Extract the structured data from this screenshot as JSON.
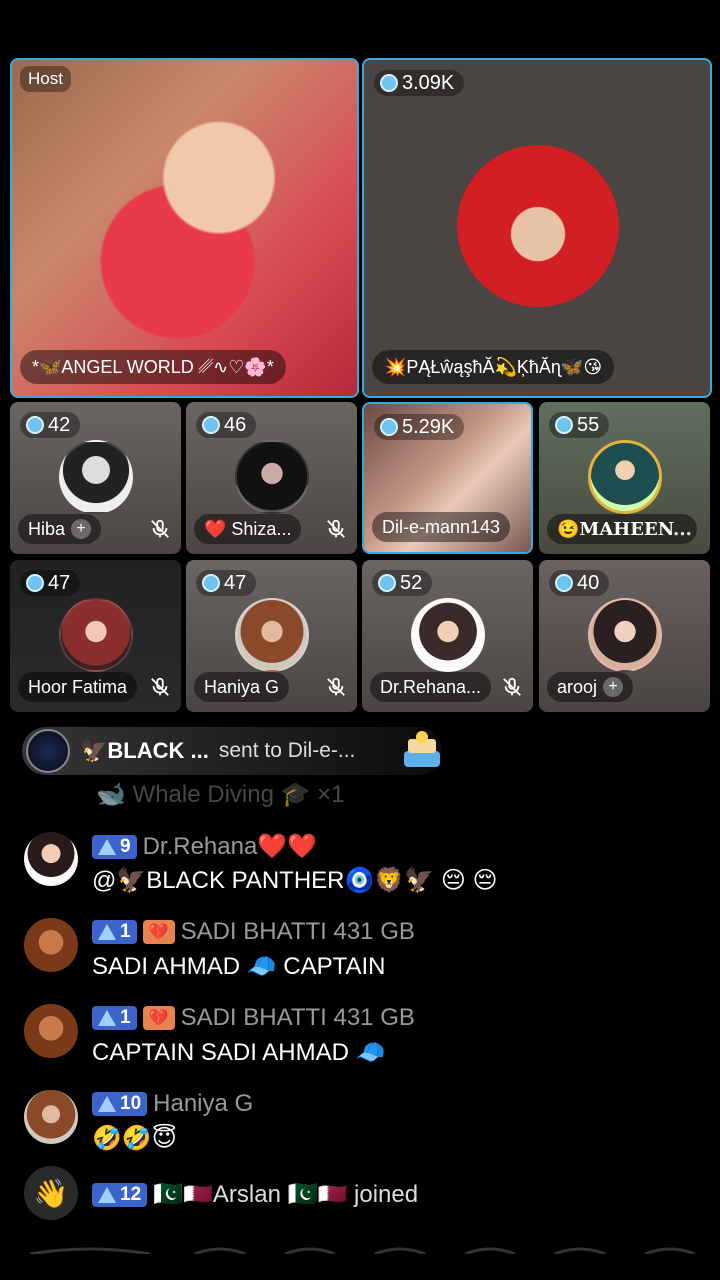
{
  "seats": {
    "host": {
      "badge": "Host",
      "name": "*🦋ANGEL WORLD ␥∿♡🌸*"
    },
    "seat1": {
      "count": "3.09K",
      "name": "💥PĄŁŵąşħĂ💫ĶħĂɳ🦋😘"
    },
    "row1": [
      {
        "count": "42",
        "name": "Hiba",
        "has_plus": true,
        "muted": true
      },
      {
        "count": "46",
        "name": "❤️ Shiza...",
        "muted": true
      },
      {
        "count": "5.29K",
        "name": "Dil-e-mann143",
        "active": true
      },
      {
        "count": "55",
        "name": "😉MAHEEN..."
      }
    ],
    "row2": [
      {
        "count": "47",
        "name": "Hoor Fatima",
        "muted": true
      },
      {
        "count": "47",
        "name": "Haniya G",
        "muted": true
      },
      {
        "count": "52",
        "name": "Dr.Rehana...",
        "muted": true
      },
      {
        "count": "40",
        "name": "arooj",
        "has_plus": true
      }
    ]
  },
  "gift": {
    "sender": "🦅BLACK ...",
    "text": "sent to Dil-e-..."
  },
  "faded_row": "🐋 Whale Diving 🎓 ×1",
  "chat": [
    {
      "level": "9",
      "name": "Dr.Rehana❤️❤️",
      "text": "@🦅BLACK PANTHER🧿🦁🦅 😔 😔",
      "color": "#2f5bb8"
    },
    {
      "level": "1",
      "name": "SADI BHATTI 431 GB",
      "text": "SADI AHMAD 🧢 CAPTAIN",
      "heart": true
    },
    {
      "level": "1",
      "name": "SADI BHATTI 431 GB",
      "text": "CAPTAIN SADI AHMAD 🧢",
      "heart": true
    },
    {
      "level": "10",
      "name": "Haniya G",
      "text": "🤣🤣😇"
    }
  ],
  "join": {
    "level": "12",
    "text": "🇵🇰🇶🇦Arslan 🇵🇰🇶🇦 joined"
  }
}
